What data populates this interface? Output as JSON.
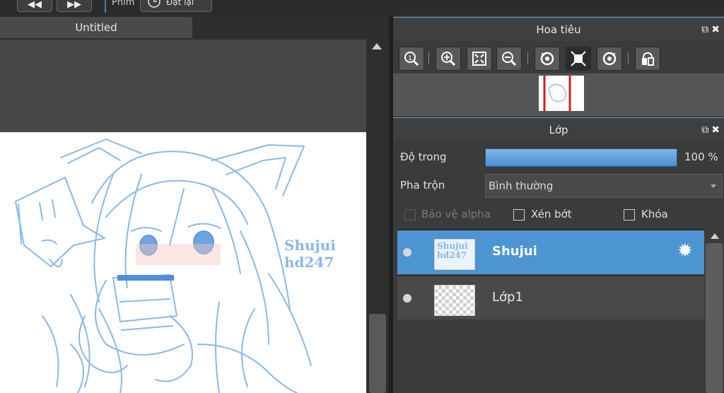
{
  "toolbar": {
    "film_label": "Phim",
    "reset_label": "Đặt lại"
  },
  "document": {
    "tab_title": "Untitled"
  },
  "canvas": {
    "watermark_line1": "Shujui",
    "watermark_line2": "hd247"
  },
  "navigator": {
    "title": "Hoa tiêu",
    "tools": [
      "zoom-actual-icon",
      "zoom-in-icon",
      "fit-icon",
      "zoom-out-icon",
      "rotate-left-icon",
      "fit-window-icon",
      "rotate-right-icon",
      "flip-icon"
    ]
  },
  "layers": {
    "title": "Lớp",
    "opacity_label": "Độ trong",
    "opacity_value": "100 %",
    "opacity_fraction": 1.0,
    "blend_label": "Pha trộn",
    "blend_value": "Bình thường",
    "protect_alpha_label": "Bảo vệ alpha",
    "clip_label": "Xén bớt",
    "lock_label": "Khóa",
    "items": [
      {
        "name": "Shujui",
        "thumb_text": "Shujui hd247",
        "selected": true
      },
      {
        "name": "Lớp1",
        "selected": false
      }
    ]
  },
  "colors": {
    "accent": "#4c94d2",
    "sketch": "#8ab8ea",
    "panel_bg": "#3b3b3b"
  }
}
